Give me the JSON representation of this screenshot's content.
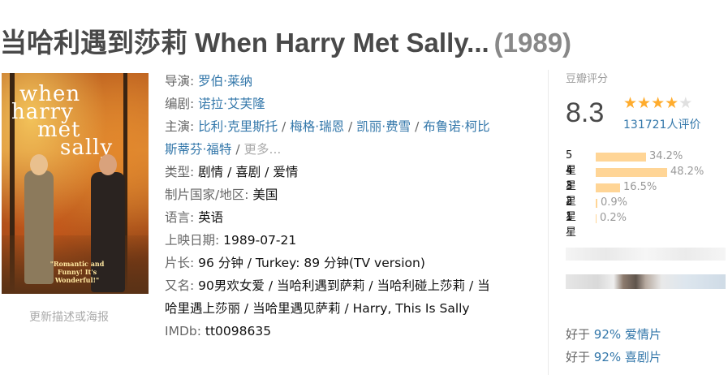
{
  "title": {
    "main": "当哈利遇到莎莉 When Harry Met Sally...",
    "year": "(1989)"
  },
  "poster": {
    "title_lines": [
      "when",
      "harry",
      "met",
      "sally"
    ],
    "tagline": "\"Romantic and Funny! It's Wonderful!\"",
    "update_link": "更新描述或海报"
  },
  "info": {
    "director": {
      "label": "导演:",
      "names": [
        "罗伯·莱纳"
      ]
    },
    "writer": {
      "label": "编剧:",
      "names": [
        "诺拉·艾芙隆"
      ]
    },
    "cast": {
      "label": "主演:",
      "names": [
        "比利·克里斯托",
        "梅格·瑞恩",
        "凯丽·费雪",
        "布鲁诺·柯比",
        "斯蒂芬·福特"
      ],
      "more": "更多..."
    },
    "genre": {
      "label": "类型:",
      "value": "剧情 / 喜剧 / 爱情"
    },
    "country": {
      "label": "制片国家/地区:",
      "value": "美国"
    },
    "language": {
      "label": "语言:",
      "value": "英语"
    },
    "release": {
      "label": "上映日期:",
      "value": "1989-07-21"
    },
    "runtime": {
      "label": "片长:",
      "value": "96 分钟 / Turkey: 89 分钟(TV version)"
    },
    "aka": {
      "label": "又名:",
      "line1": "90男欢女爱 / 当哈利遇到萨莉 / 当哈利碰上莎莉 / 当",
      "line2": "哈里遇上莎丽 / 当哈里遇见萨莉 / Harry, This Is Sally"
    },
    "imdb": {
      "label": "IMDb:",
      "value": "tt0098635"
    }
  },
  "rating": {
    "label": "豆瓣评分",
    "score": "8.3",
    "stars": 4,
    "votes": "131721人评价",
    "distribution": [
      {
        "label": "5星",
        "percent": "34.2%",
        "value": 34.2
      },
      {
        "label": "4星",
        "percent": "48.2%",
        "value": 48.2
      },
      {
        "label": "3星",
        "percent": "16.5%",
        "value": 16.5
      },
      {
        "label": "2星",
        "percent": "0.9%",
        "value": 0.9
      },
      {
        "label": "1星",
        "percent": "0.2%",
        "value": 0.2
      }
    ]
  },
  "better_than": [
    {
      "prefix": "好于",
      "percent": "92%",
      "category": "爱情片"
    },
    {
      "prefix": "好于",
      "percent": "92%",
      "category": "喜剧片"
    }
  ],
  "colors": {
    "link": "#3377aa",
    "star": "#ffac2d",
    "bar": "#ffd596",
    "title": "#494949"
  }
}
